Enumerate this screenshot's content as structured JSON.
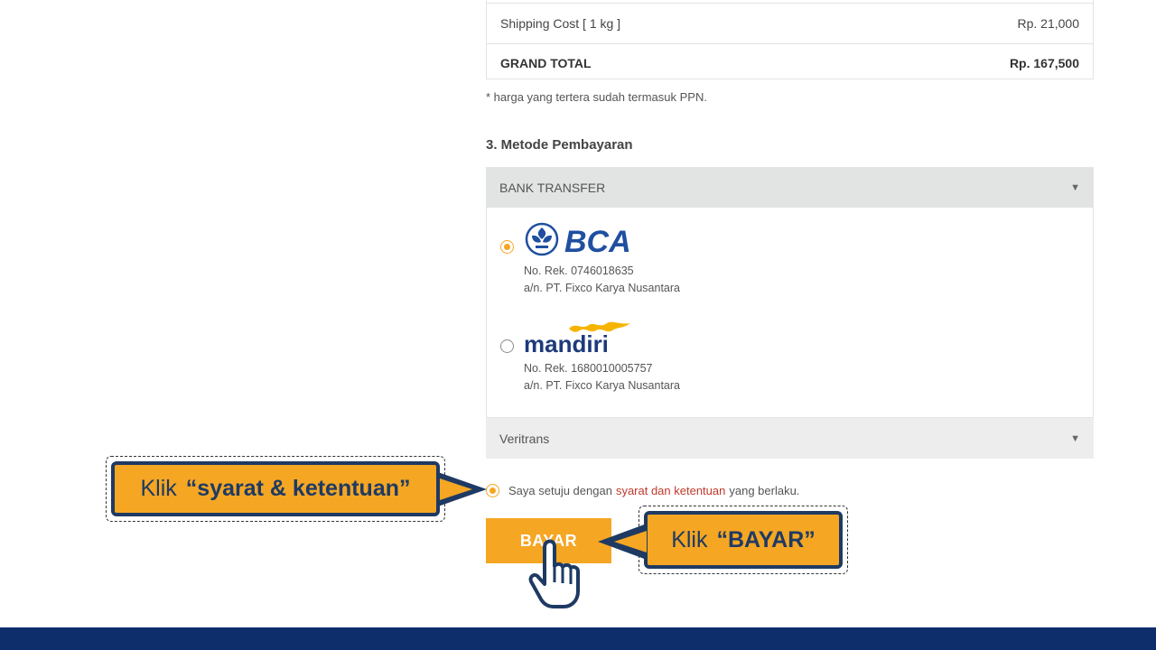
{
  "summary": {
    "shipping_label": "Shipping Cost [ 1 kg ]",
    "shipping_value": "Rp. 21,000",
    "total_label": "GRAND TOTAL",
    "total_value": "Rp. 167,500"
  },
  "ppn_note": "* harga yang tertera sudah termasuk PPN.",
  "payment": {
    "section_title": "3. Metode Pembayaran",
    "bank_transfer_label": "BANK TRANSFER",
    "veritrans_label": "Veritrans",
    "banks": [
      {
        "name": "BCA",
        "logo_text": "BCA",
        "account": "No. Rek. 0746018635",
        "holder": "a/n. PT. Fixco Karya Nusantara",
        "selected": true
      },
      {
        "name": "mandiri",
        "logo_text": "mandiri",
        "account": "No. Rek. 1680010005757",
        "holder": "a/n. PT. Fixco Karya Nusantara",
        "selected": false
      }
    ]
  },
  "agreement": {
    "before": "Saya setuju dengan",
    "link": "syarat dan ketentuan",
    "after": "yang berlaku."
  },
  "pay_button": "BAYAR",
  "callouts": {
    "terms": {
      "prefix": "Klik",
      "emphasis": "“syarat & ketentuan”"
    },
    "pay": {
      "prefix": "Klik",
      "emphasis": "“BAYAR”"
    }
  },
  "colors": {
    "accent": "#f5a623",
    "navy": "#1e3a63",
    "footer": "#0d2d6b",
    "link": "#c0392b"
  }
}
